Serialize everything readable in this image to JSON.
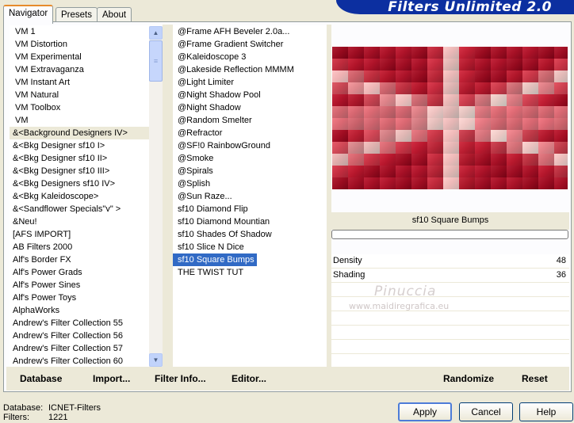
{
  "app": {
    "title": "Filters Unlimited 2.0"
  },
  "tabs": [
    {
      "label": "Navigator",
      "active": true
    },
    {
      "label": "Presets",
      "active": false
    },
    {
      "label": "About",
      "active": false
    }
  ],
  "categories": [
    "VM 1",
    "VM Distortion",
    "VM Experimental",
    "VM Extravaganza",
    "VM Instant Art",
    "VM Natural",
    "VM Toolbox",
    "VM",
    "&<Background Designers IV>",
    "&<Bkg Designer sf10 I>",
    "&<Bkg Designer sf10 II>",
    "&<Bkg Designer sf10 III>",
    "&<Bkg Designers sf10 IV>",
    "&<Bkg Kaleidoscope>",
    "&<Sandflower Specials\"v\" >",
    "&Neu!",
    "[AFS IMPORT]",
    "AB Filters 2000",
    "Alf's Border FX",
    "Alf's Power Grads",
    "Alf's Power Sines",
    "Alf's Power Toys",
    "AlphaWorks",
    "Andrew's Filter Collection 55",
    "Andrew's Filter Collection 56",
    "Andrew's Filter Collection 57",
    "Andrew's Filter Collection 60"
  ],
  "selected_category": "&<Background Designers IV>",
  "filters": [
    "@Frame AFH Beveler 2.0a...",
    "@Frame Gradient Switcher",
    "@Kaleidoscope 3",
    "@Lakeside Reflection MMMM",
    "@Light Limiter",
    "@Night Shadow Pool",
    "@Night Shadow",
    "@Random Smelter",
    "@Refractor",
    "@SF!0 RainbowGround",
    "@Smoke",
    "@Spirals",
    "@Splish",
    "@Sun Raze...",
    "sf10 Diamond Flip",
    "sf10 Diamond Mountian",
    "sf10 Shades Of Shadow",
    "sf10 Slice N Dice",
    "sf10 Square Bumps",
    "THE TWIST TUT"
  ],
  "selected_filter": "sf10 Square Bumps",
  "left_buttons": {
    "database": "Database",
    "import": "Import...",
    "filter_info": "Filter Info...",
    "editor": "Editor..."
  },
  "right_buttons": {
    "randomize": "Randomize",
    "reset": "Reset"
  },
  "preview": {
    "filter_name": "sf10 Square Bumps",
    "progress": 0
  },
  "params": [
    {
      "label": "Density",
      "value": "48"
    },
    {
      "label": "Shading",
      "value": "36"
    }
  ],
  "watermark": {
    "line1": "Pinuccia",
    "line2": "www.maidiregrafica.eu"
  },
  "status": {
    "database_label": "Database:",
    "database_value": "ICNET-Filters",
    "filters_label": "Filters:",
    "filters_value": "1221"
  },
  "dialog_buttons": {
    "apply": "Apply",
    "cancel": "Cancel",
    "help": "Help"
  },
  "colors": {
    "banner": "#0c2fa0",
    "selection": "#316ac5",
    "preview_red": "#b8142a"
  }
}
